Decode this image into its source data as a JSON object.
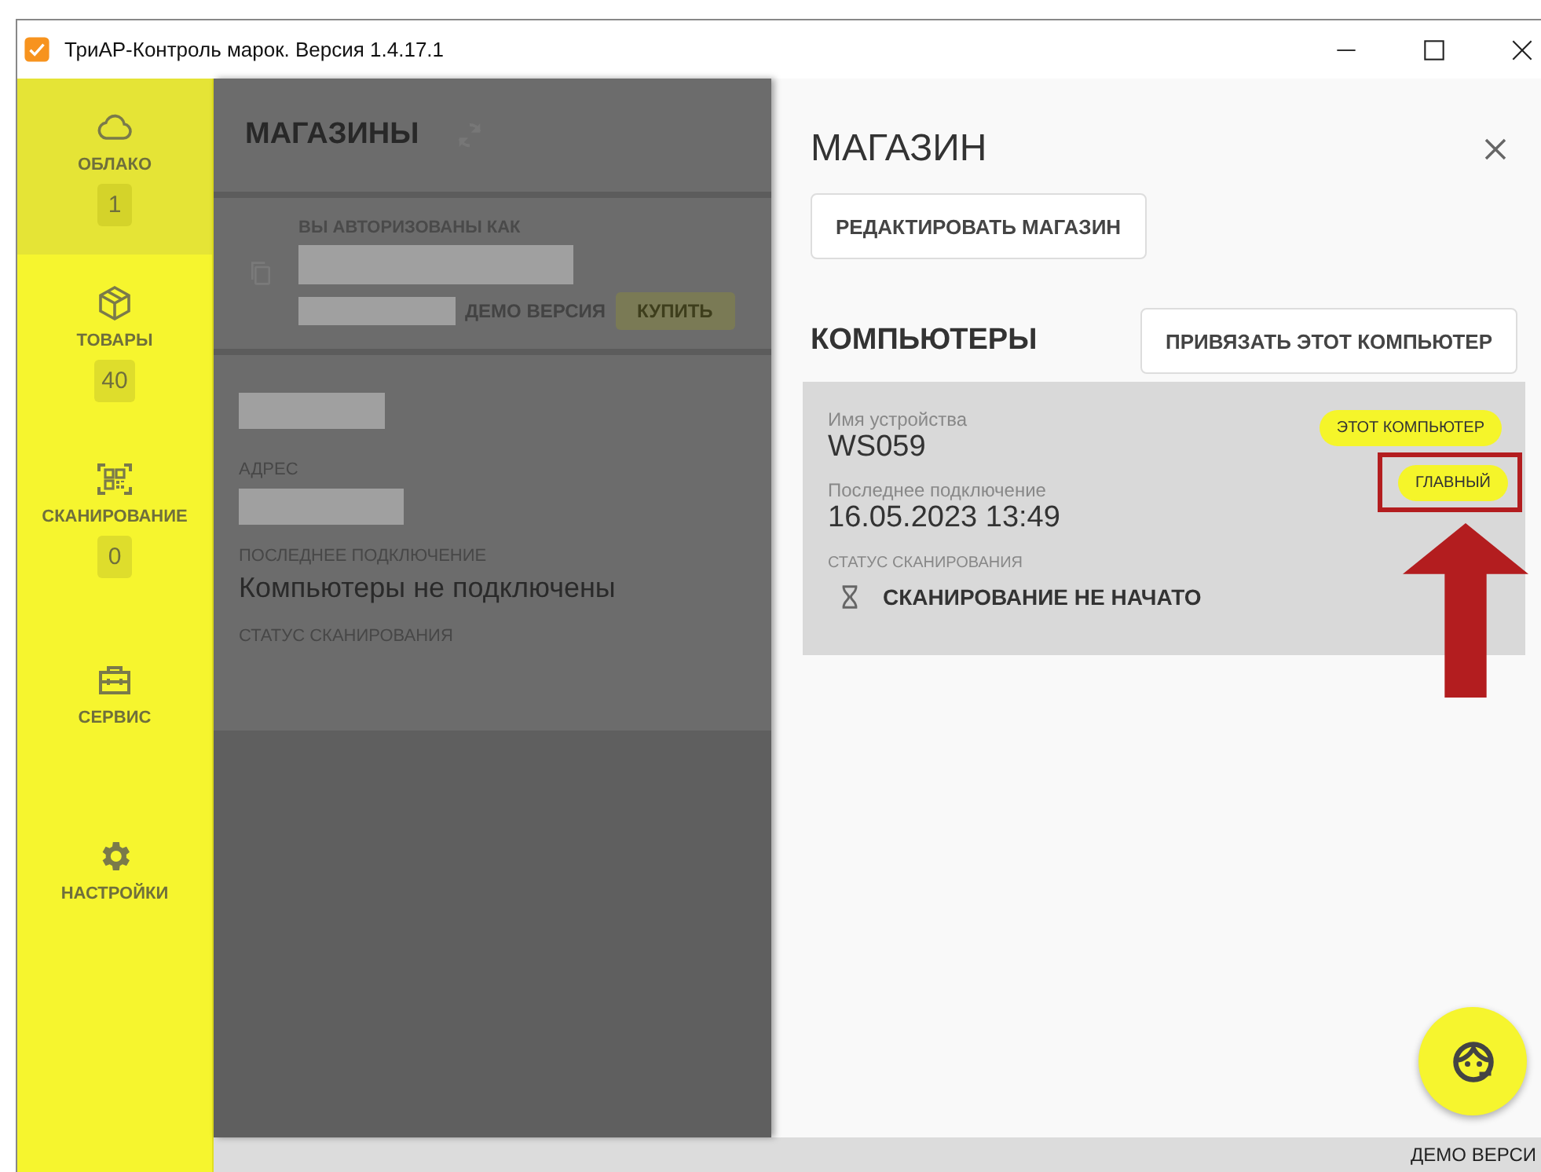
{
  "window": {
    "title": "ТриАР-Контроль марок. Версия 1.4.17.1"
  },
  "sidebar": {
    "items": [
      {
        "label": "ОБЛАКО",
        "count": "1",
        "selected": true
      },
      {
        "label": "ТОВАРЫ",
        "count": "40",
        "selected": false
      },
      {
        "label": "СКАНИРОВАНИЕ",
        "count": "0",
        "selected": false
      },
      {
        "label": "СЕРВИС",
        "selected": false
      },
      {
        "label": "НАСТРОЙКИ",
        "selected": false
      }
    ]
  },
  "stores_panel": {
    "title": "МАГАЗИНЫ",
    "account": {
      "label": "ВЫ АВТОРИЗОВАНЫ КАК",
      "edition": "ДЕМО ВЕРСИЯ",
      "buy_button": "КУПИТЬ"
    },
    "store": {
      "fields": [
        {
          "label": "АДРЕС",
          "redacted": true
        },
        {
          "label": "ПОСЛЕДНЕЕ ПОДКЛЮЧЕНИЕ",
          "value": "Компьютеры не подключены",
          "redacted": false
        },
        {
          "label": "СТАТУС СКАНИРОВАНИЯ",
          "redacted": false
        }
      ]
    }
  },
  "store_detail": {
    "title": "МАГАЗИН",
    "edit_button": "РЕДАКТИРОВАТЬ МАГАЗИН",
    "computers_title": "КОМПЬЮТЕРЫ",
    "bind_button": "ПРИВЯЗАТЬ ЭТОТ КОМПЬЮТЕР",
    "computers": [
      {
        "name_label": "Имя устройства",
        "name": "WS059",
        "last_label": "Последнее подключение",
        "last": "16.05.2023 13:49",
        "status_label": "СТАТУС СКАНИРОВАНИЯ",
        "status": "СКАНИРОВАНИЕ НЕ НАЧАТО",
        "badges": [
          {
            "label": "ЭТОТ КОМПЬЮТЕР",
            "highlighted": false
          },
          {
            "label": "ГЛАВНЫЙ",
            "highlighted": true
          }
        ]
      }
    ]
  },
  "status_bar": {
    "text": "ДЕМО ВЕРСИ"
  }
}
